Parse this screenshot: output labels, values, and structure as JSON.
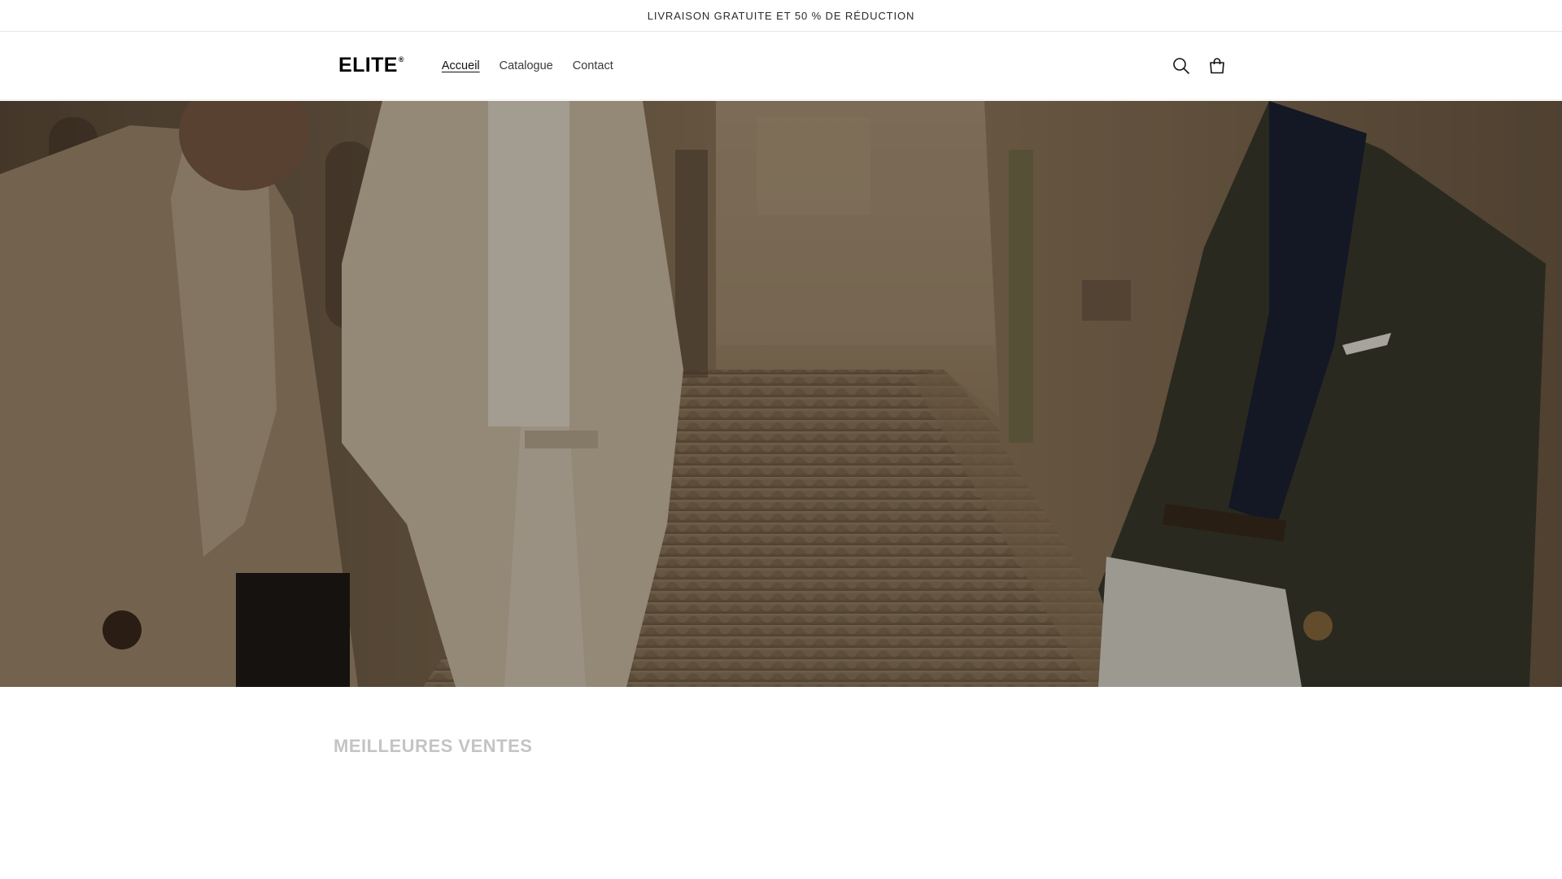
{
  "announcement": {
    "text": "LIVRAISON GRATUITE ET 50 % DE RÉDUCTION"
  },
  "header": {
    "logo_text": "ELITE",
    "logo_mark": "®",
    "nav": [
      {
        "label": "Accueil",
        "active": true
      },
      {
        "label": "Catalogue",
        "active": false
      },
      {
        "label": "Contact",
        "active": false
      }
    ],
    "icons": [
      "search-icon",
      "cart-icon"
    ]
  },
  "hero": {
    "image": "three-men-in-tailored-jackets-on-cobblestone-street"
  },
  "sections": {
    "best_sellers_title": "MEILLEURES VENTES"
  },
  "colors": {
    "text": "#121212",
    "muted_heading": "#c4c4c4",
    "hero_tone": "#6e5a43"
  }
}
